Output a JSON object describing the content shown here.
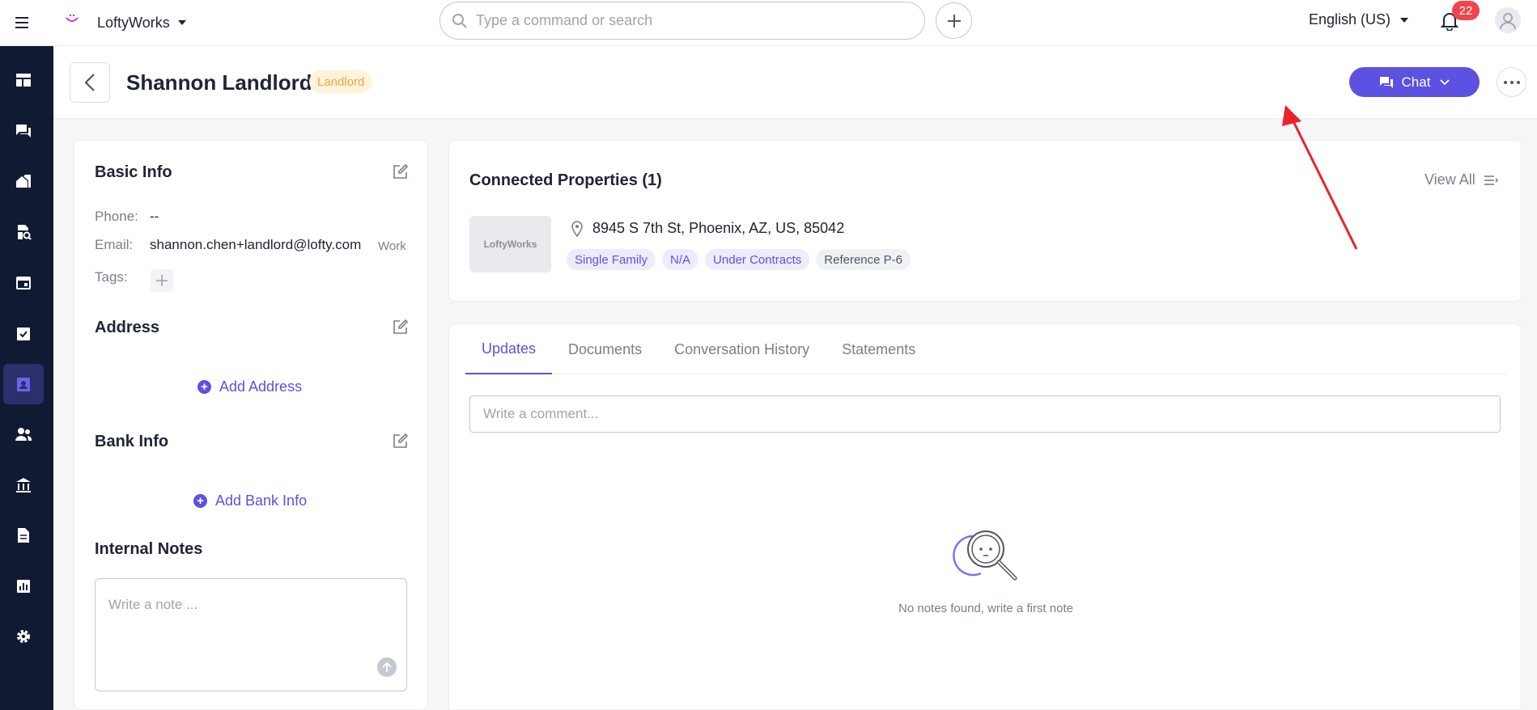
{
  "topbar": {
    "brand_name": "LoftyWorks",
    "search_placeholder": "Type a command or search",
    "language": "English (US)",
    "notification_count": "22"
  },
  "sidebar": {
    "items": [
      {
        "icon": "dashboard-icon"
      },
      {
        "icon": "messages-icon"
      },
      {
        "icon": "properties-icon"
      },
      {
        "icon": "leasing-icon"
      },
      {
        "icon": "calendar-icon"
      },
      {
        "icon": "tasks-icon"
      },
      {
        "icon": "contacts-icon",
        "active": true
      },
      {
        "icon": "people-icon"
      },
      {
        "icon": "accounting-icon"
      },
      {
        "icon": "documents-icon"
      },
      {
        "icon": "reports-icon"
      },
      {
        "icon": "settings-icon"
      }
    ]
  },
  "header": {
    "title": "Shannon Landlord",
    "role_tag": "Landlord",
    "chat_label": "Chat"
  },
  "basic_info": {
    "title": "Basic Info",
    "phone_label": "Phone:",
    "phone_value": "--",
    "email_label": "Email:",
    "email_value": "shannon.chen+landlord@lofty.com",
    "email_type": "Work",
    "tags_label": "Tags:"
  },
  "address": {
    "title": "Address",
    "add_label": "Add Address"
  },
  "bank_info": {
    "title": "Bank Info",
    "add_label": "Add Bank Info"
  },
  "internal_notes": {
    "title": "Internal Notes",
    "placeholder": "Write a note ..."
  },
  "connected_properties": {
    "title": "Connected Properties (1)",
    "view_all": "View All",
    "thumb_text": "LoftyWorks",
    "address": "8945 S 7th St, Phoenix, AZ, US, 85042",
    "tags": [
      "Single Family",
      "N/A",
      "Under Contracts",
      "Reference P-6"
    ]
  },
  "updates": {
    "tabs": [
      "Updates",
      "Documents",
      "Conversation History",
      "Statements"
    ],
    "active_tab": "Updates",
    "comment_placeholder": "Write a comment...",
    "empty_text": "No notes found, write a first note"
  },
  "colors": {
    "accent": "#5d51e2",
    "sidebar_bg": "#101a33",
    "badge": "#f0454c",
    "landlord_tag_bg": "#fff3dc",
    "landlord_tag_text": "#f0a640",
    "annotation_arrow": "#e8232a"
  }
}
